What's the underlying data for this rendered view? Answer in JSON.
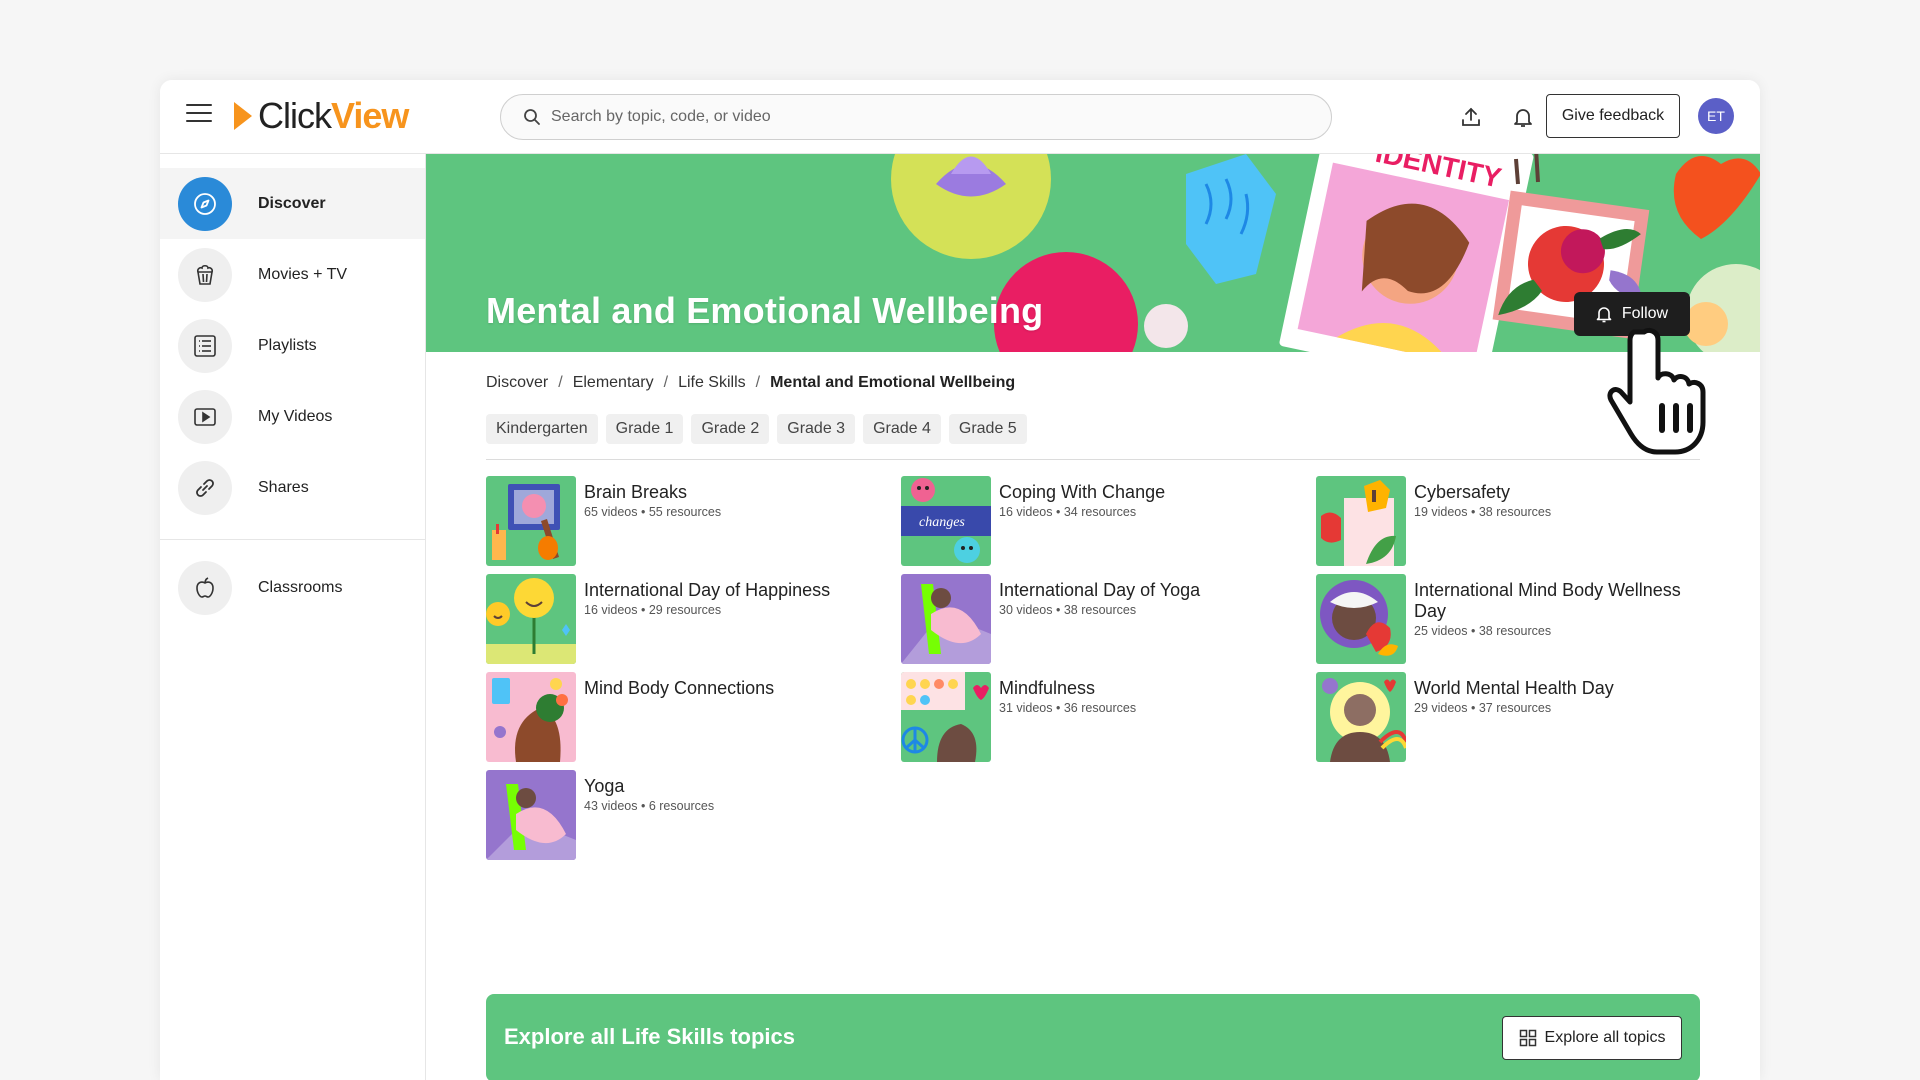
{
  "app": {
    "logo_click": "Click",
    "logo_view": "View"
  },
  "header": {
    "search_placeholder": "Search by topic, code, or video",
    "feedback_label": "Give feedback",
    "avatar_initials": "ET"
  },
  "sidebar": {
    "items": [
      {
        "label": "Discover",
        "icon": "compass-icon"
      },
      {
        "label": "Movies + TV",
        "icon": "popcorn-icon"
      },
      {
        "label": "Playlists",
        "icon": "list-icon"
      },
      {
        "label": "My Videos",
        "icon": "play-icon"
      },
      {
        "label": "Shares",
        "icon": "link-icon"
      }
    ],
    "classrooms_label": "Classrooms"
  },
  "banner": {
    "title": "Mental and Emotional Wellbeing",
    "follow_label": "Follow",
    "art_text": "IDENTITY"
  },
  "breadcrumb": [
    "Discover",
    "Elementary",
    "Life Skills",
    "Mental and Emotional Wellbeing"
  ],
  "grades": [
    "Kindergarten",
    "Grade 1",
    "Grade 2",
    "Grade 3",
    "Grade 4",
    "Grade 5"
  ],
  "topics": [
    {
      "title": "Brain Breaks",
      "meta": "65 videos • 55 resources"
    },
    {
      "title": "Coping With Change",
      "meta": "16 videos • 34 resources",
      "thumb_text": "changes"
    },
    {
      "title": "Cybersafety",
      "meta": "19 videos • 38 resources"
    },
    {
      "title": "International Day of Happiness",
      "meta": "16 videos • 29 resources"
    },
    {
      "title": "International Day of Yoga",
      "meta": "30 videos • 38 resources"
    },
    {
      "title": "International Mind Body Wellness Day",
      "meta": "25 videos • 38 resources"
    },
    {
      "title": "Mind Body Connections",
      "meta": ""
    },
    {
      "title": "Mindfulness",
      "meta": "31 videos • 36 resources"
    },
    {
      "title": "World Mental Health Day",
      "meta": "29 videos • 37 resources"
    },
    {
      "title": "Yoga",
      "meta": "43 videos • 6 resources"
    }
  ],
  "explore": {
    "title": "Explore all Life Skills topics",
    "button_label": "Explore all topics"
  },
  "colors": {
    "brand_orange": "#f7941d",
    "banner_green": "#5ec57f",
    "active_blue": "#2a8ad8"
  }
}
